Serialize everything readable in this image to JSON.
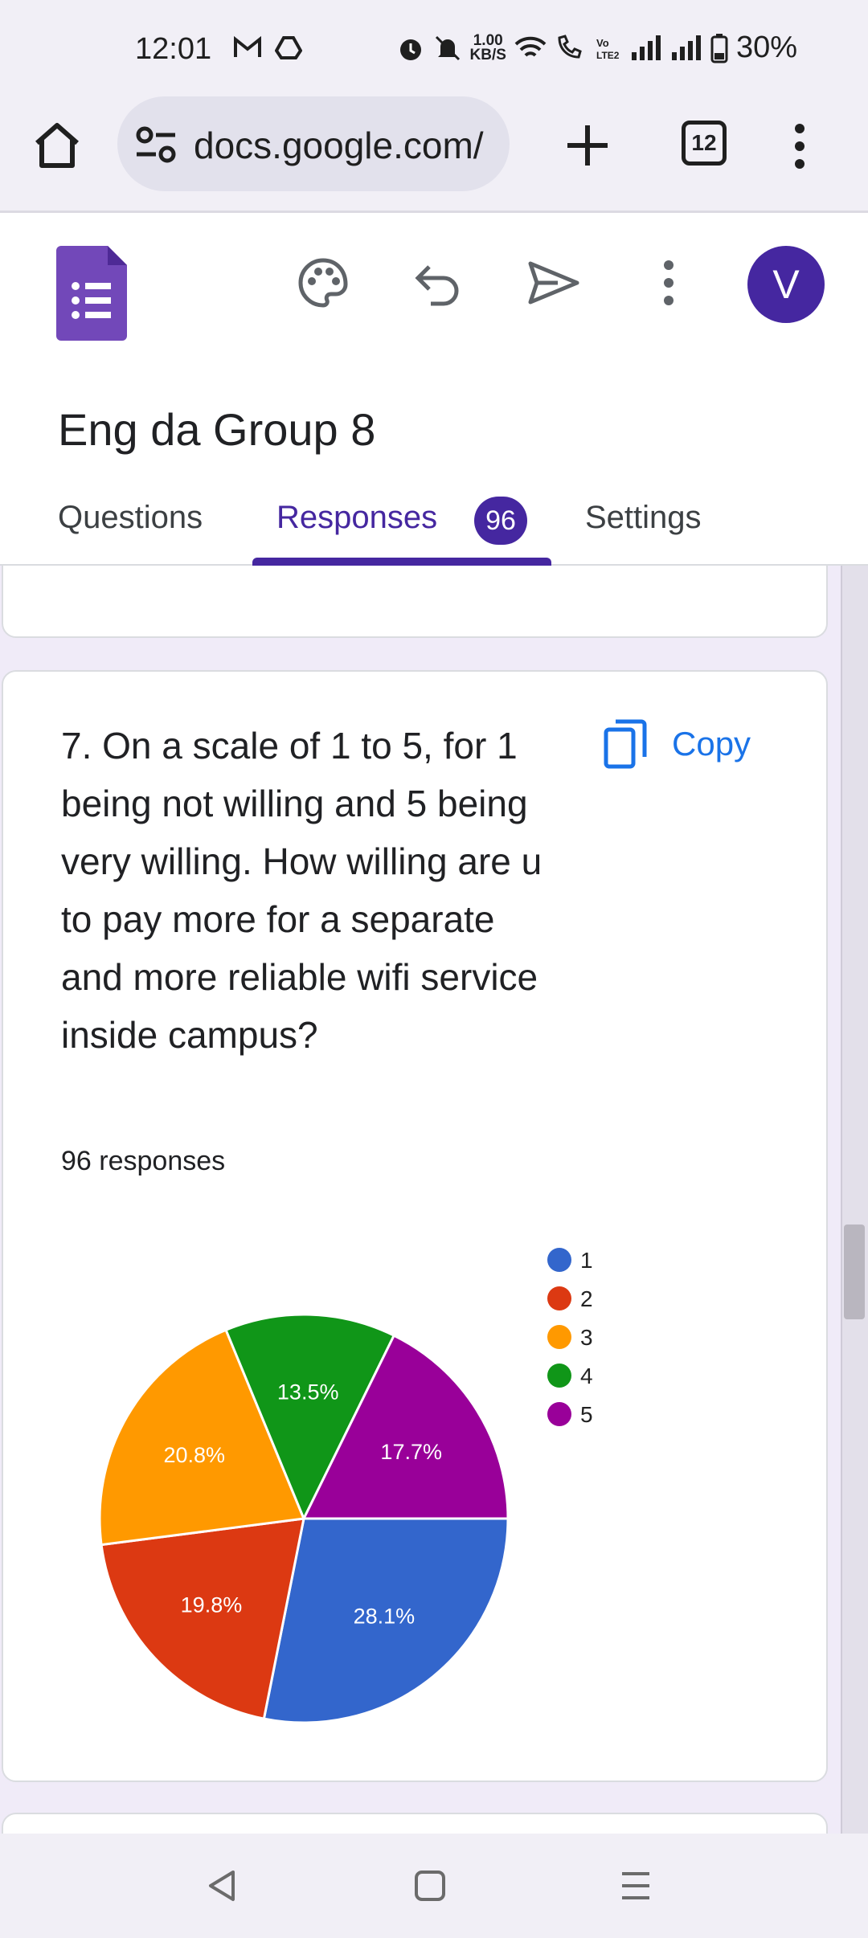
{
  "status": {
    "time": "12:01",
    "net_speed_top": "1.00",
    "net_speed_bottom": "KB/S",
    "battery": "30%"
  },
  "browser": {
    "url": "docs.google.com/",
    "tab_count": "12"
  },
  "form": {
    "title": "Eng da Group 8",
    "avatar_letter": "V",
    "tabs": {
      "questions": "Questions",
      "responses": "Responses",
      "responses_badge": "96",
      "settings": "Settings"
    }
  },
  "question_card": {
    "question": "7. On a scale of 1 to 5, for 1 being not willing and 5 being very willing. How willing are u to pay more for a separate and more reliable wifi service inside campus?",
    "copy_label": "Copy",
    "responses_count": "96 responses"
  },
  "colors": {
    "accent": "#4527a0",
    "link": "#1a73e8",
    "background": "#f0ebf8"
  },
  "chart_data": {
    "type": "pie",
    "legend_position": "right",
    "slices": [
      {
        "label": "1",
        "percent": 28.1,
        "percent_label": "28.1%",
        "color": "#3366cc"
      },
      {
        "label": "2",
        "percent": 19.8,
        "percent_label": "19.8%",
        "color": "#dc3912"
      },
      {
        "label": "3",
        "percent": 20.8,
        "percent_label": "20.8%",
        "color": "#ff9900"
      },
      {
        "label": "4",
        "percent": 13.5,
        "percent_label": "13.5%",
        "color": "#109618"
      },
      {
        "label": "5",
        "percent": 17.7,
        "percent_label": "17.7%",
        "color": "#990099"
      }
    ]
  }
}
